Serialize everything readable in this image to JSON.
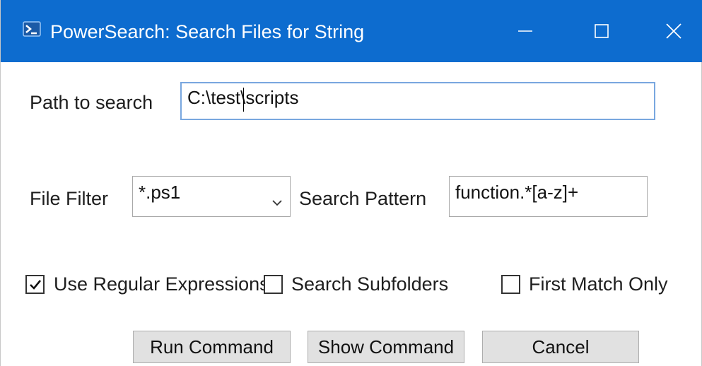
{
  "window": {
    "title": "PowerSearch: Search Files for String",
    "icon": "powershell-icon",
    "accent_color": "#0d6ccf"
  },
  "path": {
    "label": "Path to search",
    "value": "C:\\test\\scripts"
  },
  "file_filter": {
    "label": "File Filter",
    "selected": "*.ps1"
  },
  "search_pattern": {
    "label": "Search Pattern",
    "value": "function.*[a-z]+"
  },
  "options": {
    "use_regex": {
      "label": "Use Regular Expressions",
      "checked": true
    },
    "search_subfolders": {
      "label": "Search Subfolders",
      "checked": false
    },
    "first_match_only": {
      "label": "First Match Only",
      "checked": false
    }
  },
  "buttons": {
    "run": "Run Command",
    "show": "Show Command",
    "cancel": "Cancel"
  }
}
